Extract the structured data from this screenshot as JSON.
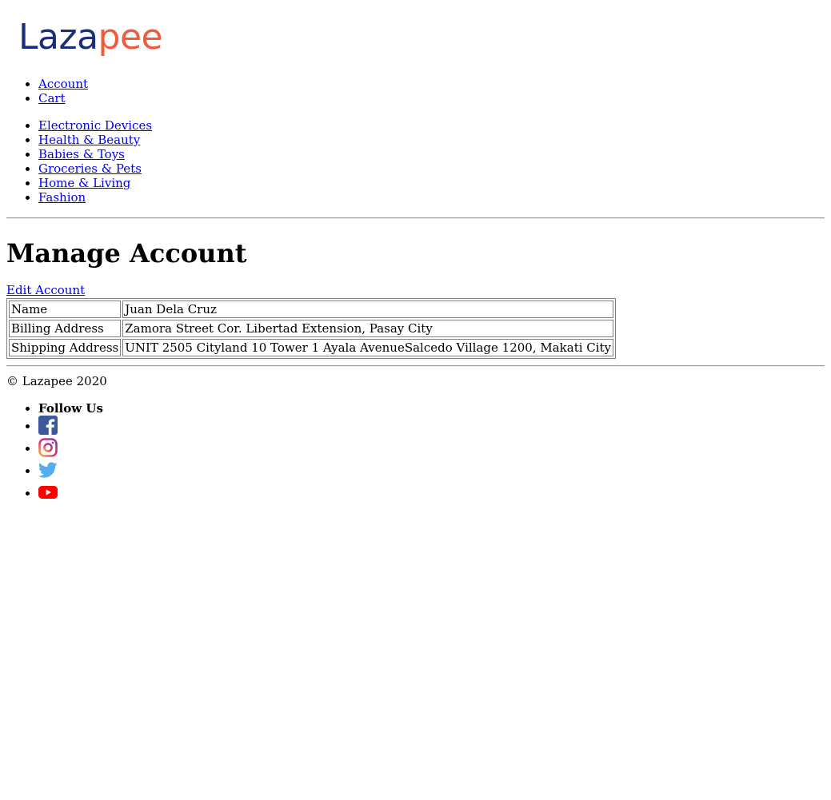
{
  "brand": {
    "logo_part1": "Laza",
    "logo_part2": "pee"
  },
  "nav": [
    {
      "label": "Account"
    },
    {
      "label": "Cart"
    }
  ],
  "categories": [
    {
      "label": "Electronic Devices"
    },
    {
      "label": "Health & Beauty"
    },
    {
      "label": "Babies & Toys"
    },
    {
      "label": "Groceries & Pets"
    },
    {
      "label": "Home & Living"
    },
    {
      "label": "Fashion"
    }
  ],
  "main": {
    "title": "Manage Account",
    "edit_link": "Edit Account",
    "rows": [
      {
        "label": "Name",
        "value": "Juan Dela Cruz"
      },
      {
        "label": "Billing Address",
        "value": "Zamora Street Cor. Libertad Extension, Pasay City"
      },
      {
        "label": "Shipping Address",
        "value": "UNIT 2505 Cityland 10 Tower 1 Ayala AvenueSalcedo Village 1200, Makati City"
      }
    ]
  },
  "footer": {
    "copyright": "© Lazapee 2020",
    "follow_label": "Follow Us",
    "social": [
      {
        "icon": "facebook-icon",
        "color": "#3b5998"
      },
      {
        "icon": "instagram-icon",
        "color": "#d6249f"
      },
      {
        "icon": "twitter-icon",
        "color": "#55acee"
      },
      {
        "icon": "youtube-icon",
        "color": "#ff0000"
      }
    ]
  },
  "colors": {
    "link": "#0000ee",
    "logo_dark": "#1a2e7a",
    "logo_accent": "#f25a3c"
  }
}
